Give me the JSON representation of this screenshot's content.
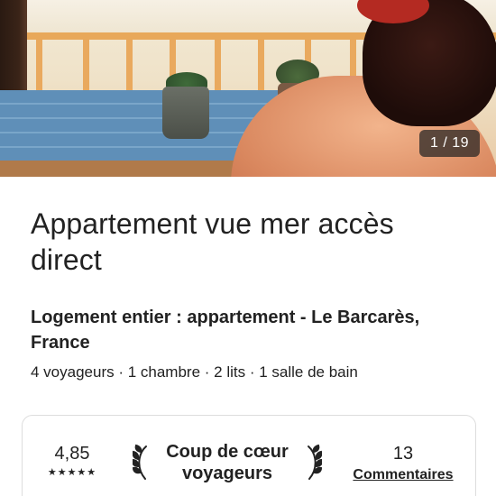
{
  "photo": {
    "counter": "1 / 19"
  },
  "listing": {
    "title": "Appartement vue mer accès direct",
    "subtitle": "Logement entier : appartement - Le Barcarès, France",
    "details": "4 voyageurs · 1 chambre · 2 lits · 1 salle de bain"
  },
  "rating_card": {
    "rating": "4,85",
    "stars": "★★★★★",
    "award": "Coup de cœur voyageurs",
    "review_count": "13",
    "reviews_label": "Commentaires"
  }
}
